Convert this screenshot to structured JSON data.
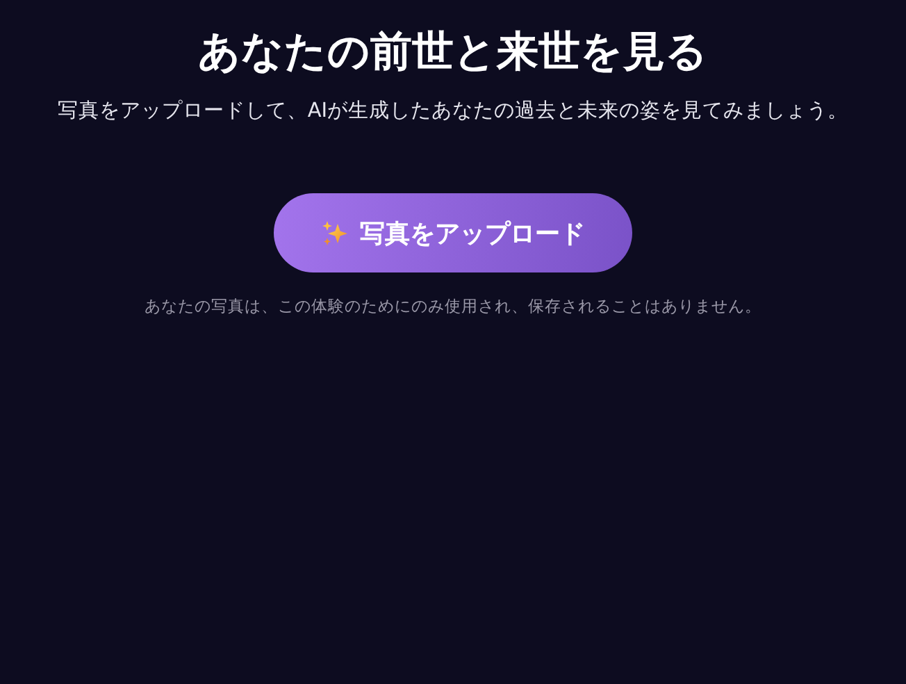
{
  "title": "あなたの前世と来世を見る",
  "subtitle": "写真をアップロードして、AIが生成したあなたの過去と未来の姿を見てみましょう。",
  "upload_button": {
    "label": "写真をアップロード"
  },
  "privacy_note": "あなたの写真は、この体験のためにのみ使用され、保存されることはありません。"
}
